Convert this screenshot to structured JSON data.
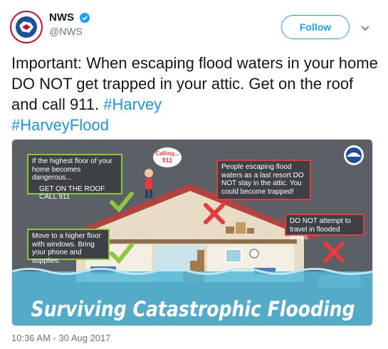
{
  "author": {
    "display_name": "NWS",
    "handle": "@NWS",
    "verified": true,
    "avatar_icon": "nws-logo-icon"
  },
  "actions": {
    "follow_label": "Follow",
    "menu_icon": "chevron-down-icon"
  },
  "tweet": {
    "text": "Important: When escaping flood waters in your home DO NOT get trapped in your attic. Get on the roof and call 911.",
    "hashtags": [
      "#Harvey",
      "#HarveyFlood"
    ]
  },
  "infographic": {
    "title": "Surviving Catastrophic Flooding",
    "speech_bubble": "Calling... 911",
    "callouts": {
      "roof": {
        "line1": "If the highest floor of your home becomes dangerous...",
        "line2": "GET ON THE ROOF CALL 911"
      },
      "attic": "People escaping flood waters as a last resort DO NOT stay in the attic. You could become trapped!",
      "travel": "DO NOT attempt to travel in flooded areas.",
      "higher_floor": "Move to a higher floor with windows. Bring your phone and supplies."
    },
    "colors": {
      "background": "#5a6066",
      "water": "#52b9d8",
      "check": "#8cc63f",
      "cross": "#e23c3c",
      "roof": "#b4433f"
    }
  },
  "meta": {
    "timestamp": "10:36 AM - 30 Aug 2017"
  }
}
